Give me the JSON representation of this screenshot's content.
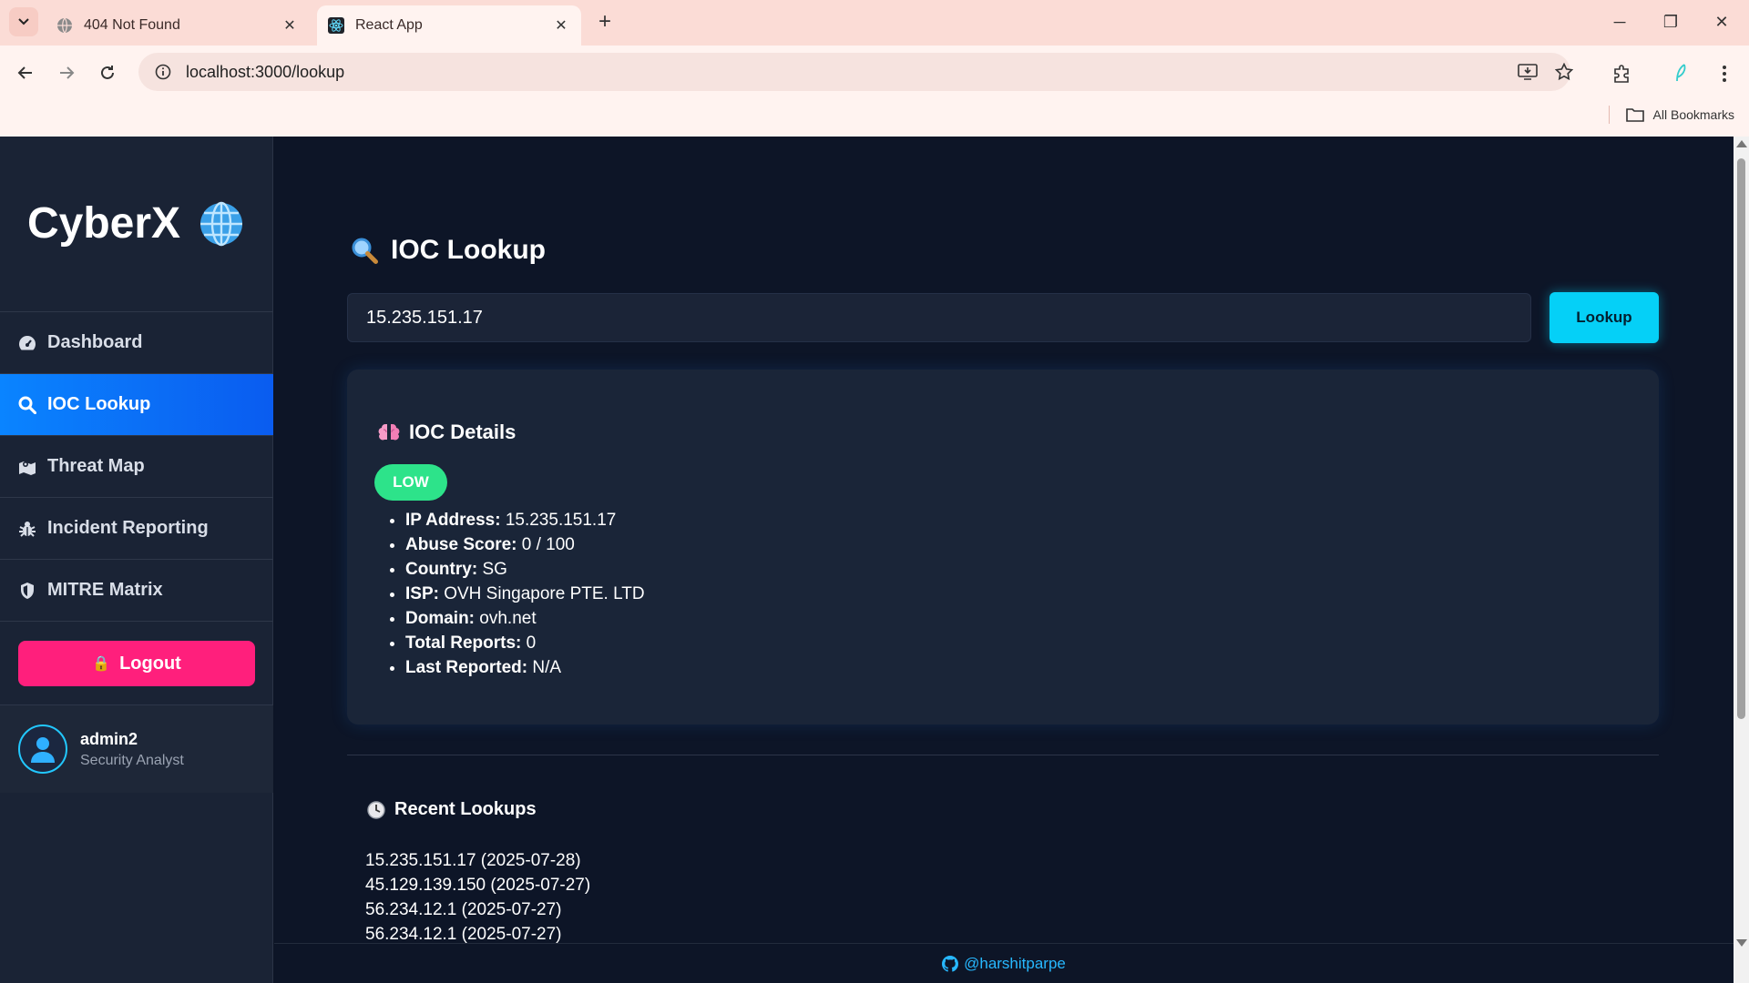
{
  "browser": {
    "tabs": [
      {
        "title": "404 Not Found",
        "active": false,
        "icon": "globe-icon"
      },
      {
        "title": "React App",
        "active": true,
        "icon": "react-icon"
      }
    ],
    "url": "localhost:3000/lookup",
    "bookmarks_label": "All Bookmarks"
  },
  "sidebar": {
    "brand": "CyberX",
    "brand_icon": "globe-emoji-icon",
    "items": [
      {
        "label": "Dashboard",
        "icon": "dashboard-gauge-icon",
        "active": false
      },
      {
        "label": "IOC Lookup",
        "icon": "search-icon",
        "active": true
      },
      {
        "label": "Threat Map",
        "icon": "map-icon",
        "active": false
      },
      {
        "label": "Incident Reporting",
        "icon": "bug-icon",
        "active": false
      },
      {
        "label": "MITRE Matrix",
        "icon": "shield-icon",
        "active": false
      }
    ],
    "logout_label": "Logout",
    "user": {
      "name": "admin2",
      "role": "Security Analyst"
    }
  },
  "main": {
    "title": "IOC Lookup",
    "search_value": "15.235.151.17",
    "lookup_label": "Lookup",
    "details": {
      "title": "IOC Details",
      "risk": "LOW",
      "fields": [
        {
          "label": "IP Address:",
          "value": "15.235.151.17"
        },
        {
          "label": "Abuse Score:",
          "value": "0 / 100"
        },
        {
          "label": "Country:",
          "value": "SG"
        },
        {
          "label": "ISP:",
          "value": "OVH Singapore PTE. LTD"
        },
        {
          "label": "Domain:",
          "value": "ovh.net"
        },
        {
          "label": "Total Reports:",
          "value": "0"
        },
        {
          "label": "Last Reported:",
          "value": "N/A"
        }
      ]
    },
    "recent": {
      "title": "Recent Lookups",
      "items": [
        "15.235.151.17 (2025-07-28)",
        "45.129.139.150 (2025-07-27)",
        "56.234.12.1 (2025-07-27)",
        "56.234.12.1 (2025-07-27)"
      ]
    }
  },
  "footer": {
    "handle": "@harshitparpe"
  },
  "colors": {
    "accent": "#05d0f7",
    "active_nav": "#0a84ff",
    "logout": "#ff1f7c",
    "risk_low": "#2de38a",
    "background": "#0d1527",
    "sidebar": "#1a2335"
  }
}
